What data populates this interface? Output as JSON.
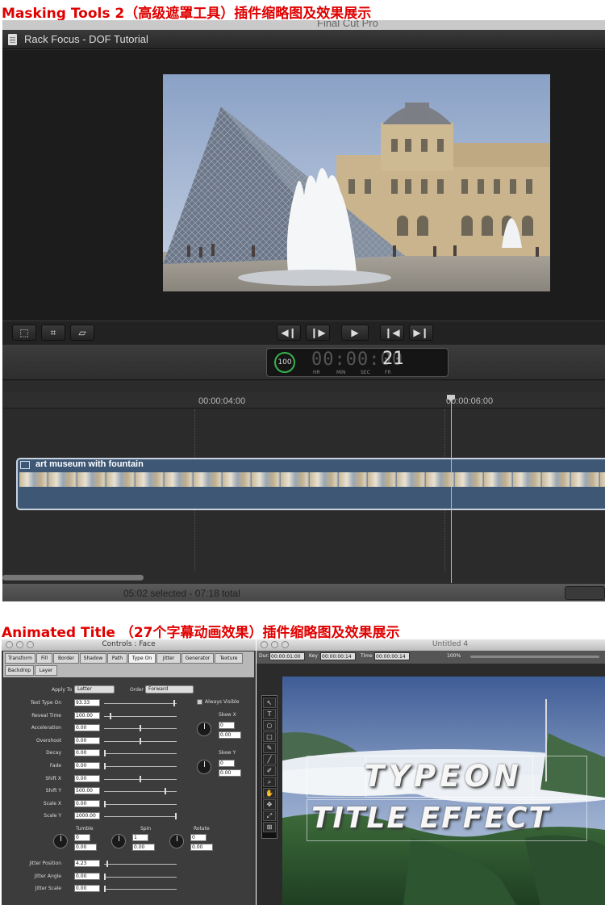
{
  "heading1": "Masking Tools 2（高级遮罩工具）插件缩略图及效果展示",
  "heading2": "Animated Title （27个字幕动画效果）插件缩略图及效果展示",
  "fcp": {
    "app_title": "Final Cut Pro",
    "project_title": "Rack Focus - DOF Tutorial",
    "timecode": {
      "percent": "100",
      "digits": "00:00:00",
      "frames": "21",
      "units": [
        "HR",
        "MIN",
        "SEC",
        "FR"
      ]
    },
    "ruler": [
      "00:00:04:00",
      "00:00:06:00"
    ],
    "clip_name": "art museum with fountain",
    "status": "05:02 selected - 07:18 total",
    "colors": {
      "clip": "#3d5775",
      "timecode_ring": "#37b24d",
      "heading": "#e00000"
    }
  },
  "controls": {
    "title": "Controls : Face",
    "tabs": [
      "Transform",
      "Fill",
      "Border",
      "Shadow",
      "Path",
      "Type On",
      "Jitter",
      "Generator",
      "Texture",
      "Backdrop",
      "Layer"
    ],
    "active_tab": "Type On",
    "apply_to_label": "Apply To",
    "apply_to": "Letter",
    "order_label": "Order",
    "order": "Forward",
    "always_visible": "Always Visible",
    "skew_x": "Skew X",
    "skew_y": "Skew Y",
    "skew_x_vals": [
      "0",
      "0.00"
    ],
    "skew_y_vals": [
      "0",
      "0.00"
    ],
    "params": [
      {
        "label": "Text Type On",
        "value": "93.33",
        "level": 0.98
      },
      {
        "label": "Reveal Time",
        "value": "100.00",
        "level": 0.08
      },
      {
        "label": "Acceleration",
        "value": "0.00",
        "level": 0.5
      },
      {
        "label": "Overshoot",
        "value": "0.00",
        "level": 0.5
      },
      {
        "label": "Decay",
        "value": "0.00",
        "level": 0.0
      },
      {
        "label": "Fade",
        "value": "0.00",
        "level": 0.0
      },
      {
        "label": "Shift X",
        "value": "0.00",
        "level": 0.5
      },
      {
        "label": "Shift Y",
        "value": "500.00",
        "level": 0.85
      },
      {
        "label": "Scale X",
        "value": "0.00",
        "level": 0.0
      },
      {
        "label": "Scale Y",
        "value": "1000.00",
        "level": 1.0
      }
    ],
    "rotation_labels": [
      "Tumble",
      "Spin",
      "Rotate"
    ],
    "rotation_vals": [
      [
        "0",
        "0.00"
      ],
      [
        "1",
        "0.00"
      ],
      [
        "0",
        "0.00"
      ]
    ],
    "jitter": [
      {
        "label": "Jitter Position",
        "value": "4.23",
        "level": 0.03
      },
      {
        "label": "Jitter Angle",
        "value": "0.00",
        "level": 0.0
      },
      {
        "label": "Jitter Scale",
        "value": "0.00",
        "level": 0.0
      }
    ]
  },
  "untitled": {
    "title": "Untitled 4",
    "dur_label": "Dur:",
    "dur": "00:00:01:00",
    "key_label": "Key",
    "key": "00:00:00:14",
    "time_label": "Time",
    "time": "00:00:00:14",
    "zoom": "100%",
    "tools": [
      "pointer",
      "T",
      "ellipse",
      "rect",
      "pen",
      "line",
      "brush",
      "zoom",
      "hand",
      "move",
      "scale",
      "crop"
    ],
    "type_line1": "TYPEON",
    "type_line2": "TITLE EFFECT"
  }
}
